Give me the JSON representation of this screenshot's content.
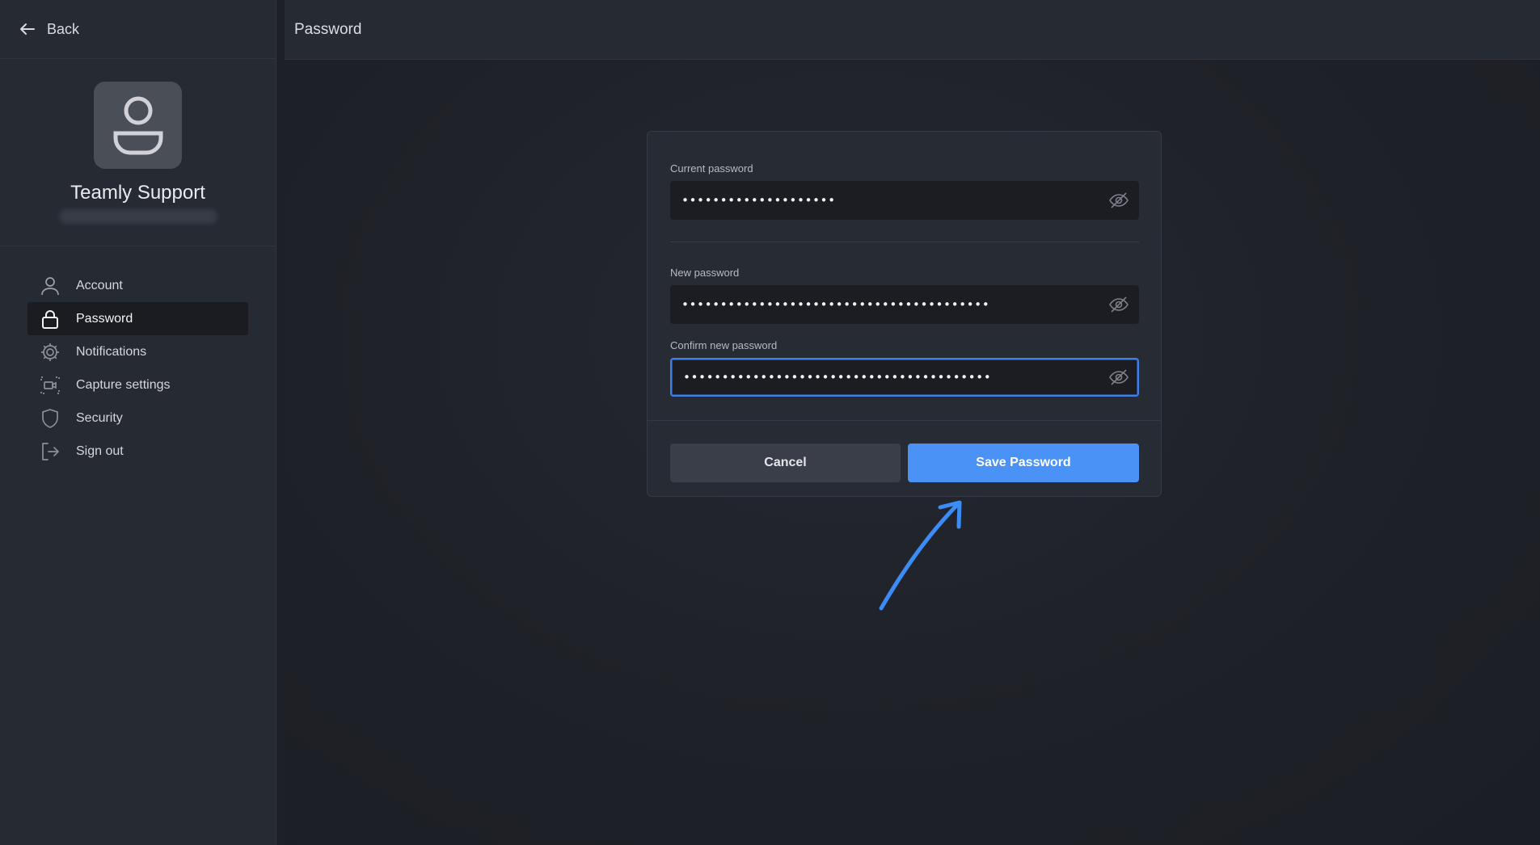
{
  "sidebar": {
    "back_label": "Back",
    "profile_name": "Teamly Support",
    "nav": [
      {
        "label": "Account",
        "icon": "user-icon"
      },
      {
        "label": "Password",
        "icon": "lock-icon",
        "active": true
      },
      {
        "label": "Notifications",
        "icon": "gear-icon"
      },
      {
        "label": "Capture settings",
        "icon": "capture-icon"
      },
      {
        "label": "Security",
        "icon": "shield-icon"
      },
      {
        "label": "Sign out",
        "icon": "sign-out-icon"
      }
    ]
  },
  "header": {
    "title": "Password"
  },
  "dialog": {
    "current_label": "Current password",
    "current_value": "••••••••••••••••••••",
    "new_label": "New password",
    "new_value": "••••••••••••••••••••••••••••••••••••••••",
    "confirm_label": "Confirm new password",
    "confirm_value": "••••••••••••••••••••••••••••••••••••••••",
    "cancel_label": "Cancel",
    "save_label": "Save Password"
  },
  "colors": {
    "accent": "#4a92f5",
    "annotation_arrow": "#3b8cf5",
    "sidebar_bg": "#262a33",
    "field_bg": "#1b1d23"
  }
}
